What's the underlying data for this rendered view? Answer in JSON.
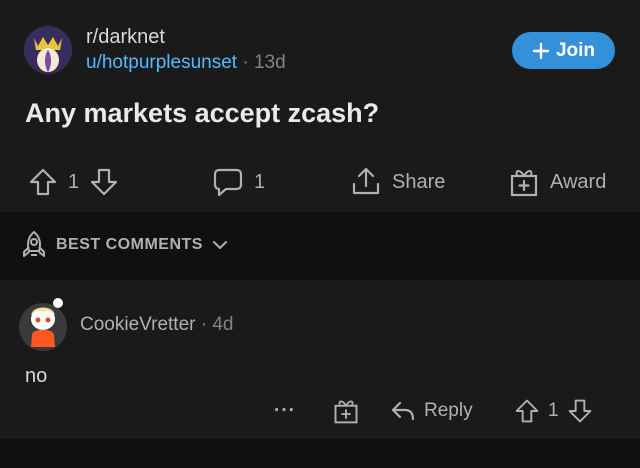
{
  "post": {
    "subreddit": "r/darknet",
    "username": "u/hotpurplesunset",
    "separator": "·",
    "age": "13d",
    "join_label": "Join",
    "title": "Any markets accept zcash?",
    "upvotes": "1",
    "comments": "1",
    "share_label": "Share",
    "award_label": "Award"
  },
  "sort": {
    "label": "BEST COMMENTS"
  },
  "comment": {
    "author": "CookieVretter",
    "separator": "·",
    "age": "4d",
    "body": "no",
    "more_label": "···",
    "reply_label": "Reply",
    "votes": "1"
  },
  "colors": {
    "background": "#1a1a1b",
    "join_button": "#3291d9",
    "username_link": "#4fbcff",
    "dark_band": "#101010"
  },
  "icons": [
    "subreddit-avatar",
    "plus-icon",
    "upvote-icon",
    "downvote-icon",
    "comment-icon",
    "share-icon",
    "award-icon",
    "rocket-icon",
    "chevron-down-icon",
    "user-avatar",
    "more-icon",
    "reply-icon"
  ]
}
